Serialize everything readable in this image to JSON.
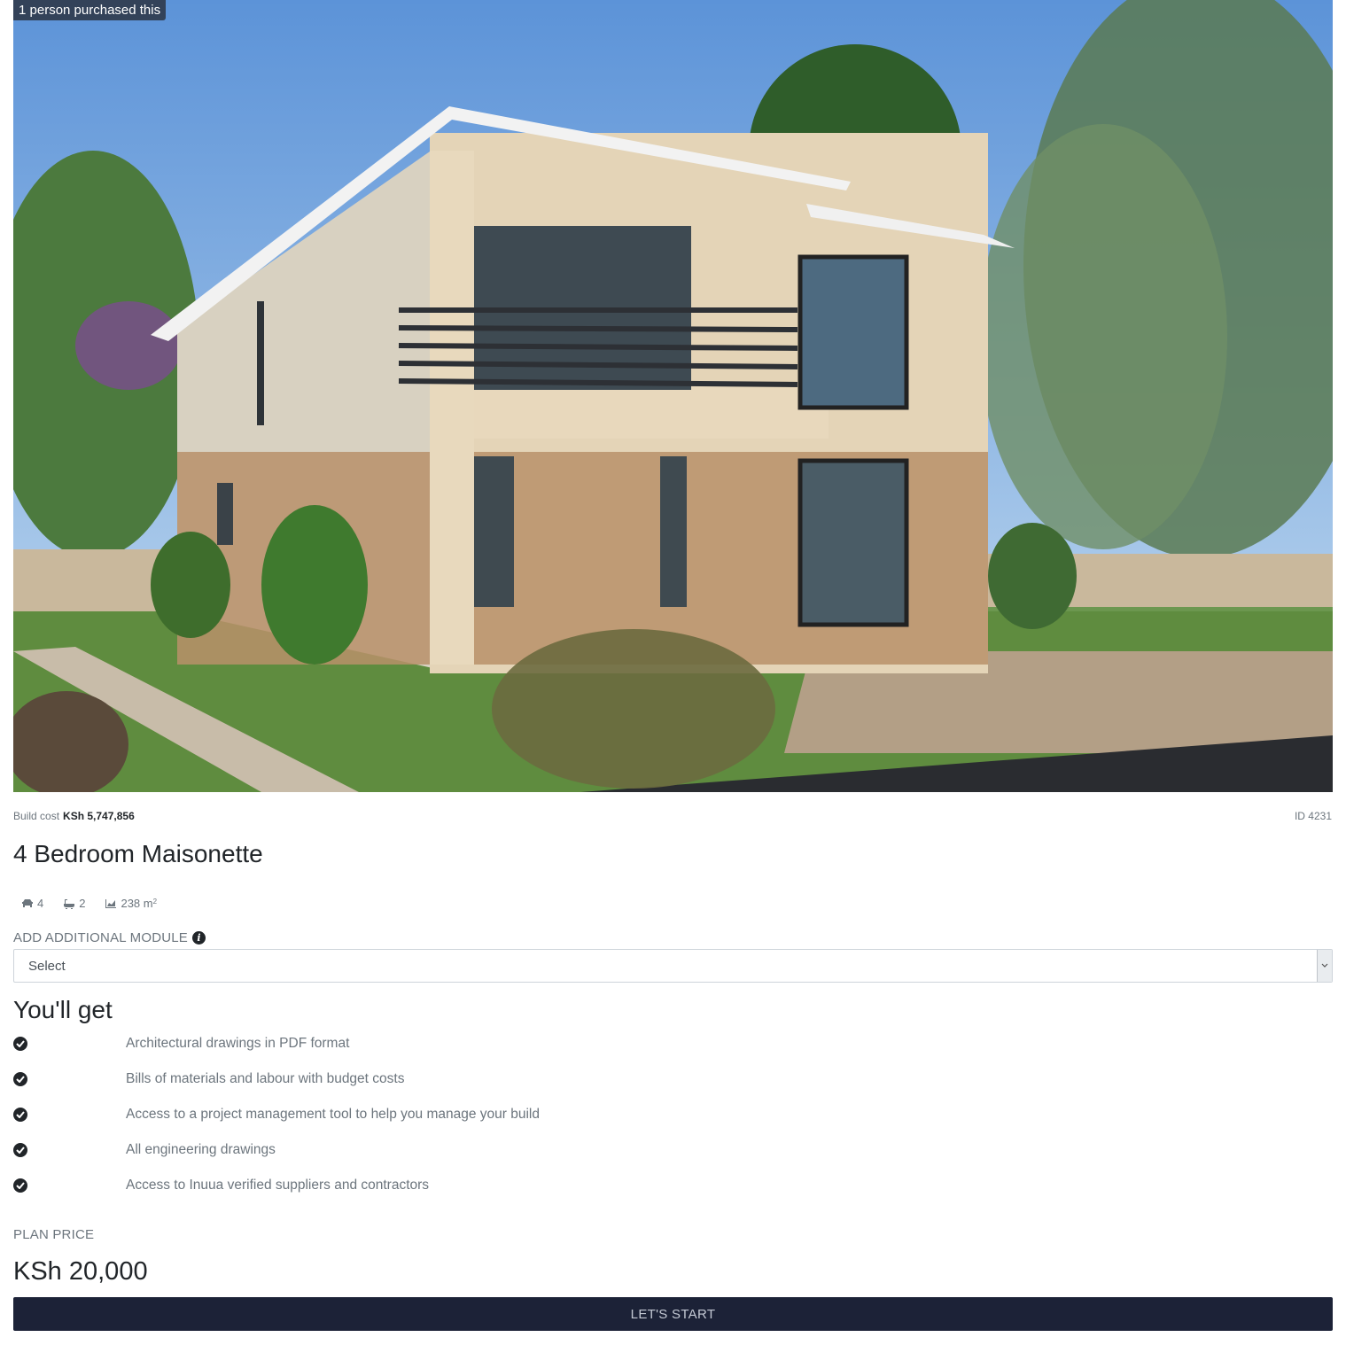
{
  "hero": {
    "badge_text": "1 person purchased this",
    "image_alt": "4 Bedroom Maisonette render"
  },
  "summary": {
    "build_cost_label": "Build cost",
    "build_cost_value": "KSh 5,747,856",
    "id_text": "ID 4231"
  },
  "title": "4 Bedroom Maisonette",
  "specs": {
    "bedrooms": "4",
    "bathrooms": "2",
    "area": "238 m",
    "area_unit_exp": "2",
    "icons": [
      "bed-icon",
      "bath-icon",
      "area-chart-icon"
    ]
  },
  "module": {
    "label": "ADD ADDITIONAL MODULE",
    "selected": "Select"
  },
  "youll_get": {
    "heading": "You'll get",
    "items": [
      "Architectural drawings in PDF format",
      "Bills of materials and labour with budget costs",
      "Access to a project management tool to help you manage your build",
      "All engineering drawings",
      "Access to Inuua verified suppliers and contractors"
    ]
  },
  "plan": {
    "label": "PLAN PRICE",
    "price": "KSh 20,000",
    "cta_label": "LET'S START"
  },
  "colors": {
    "primary_dark": "#1c2237",
    "text_muted": "#6c757d",
    "text_dark": "#212529"
  }
}
